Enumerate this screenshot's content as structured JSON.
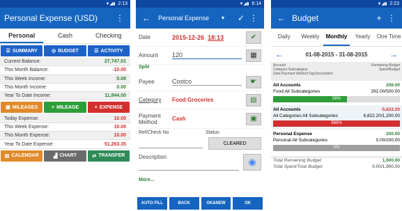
{
  "phone1": {
    "time": "2:13",
    "title": "Personal Expense (USD)",
    "tabs": [
      "Personal",
      "Cash",
      "Checking"
    ],
    "top_buttons": [
      "SUMMARY",
      "BUDGET",
      "ACTIVITY"
    ],
    "rows_a": [
      {
        "label": "Current Balance:",
        "value": "27,747.01",
        "type": "pos"
      },
      {
        "label": "This Month Balance:",
        "value": "-10.00",
        "type": "neg"
      },
      {
        "label": "This Week Income:",
        "value": "0.00",
        "type": "pos"
      },
      {
        "label": "This Month Income:",
        "value": "0.00",
        "type": "pos"
      },
      {
        "label": "Year To Date Income:",
        "value": "11,844.00",
        "type": "pos"
      }
    ],
    "mid_buttons": [
      "MILEAGES",
      "MILEAGE",
      "EXPENSE"
    ],
    "rows_b": [
      {
        "label": "Today Expense:",
        "value": "10.00",
        "type": "neg"
      },
      {
        "label": "This Week Expense:",
        "value": "10.00",
        "type": "neg"
      },
      {
        "label": "This Month Expense:",
        "value": "10.00",
        "type": "neg"
      },
      {
        "label": "Year To Date Expense:",
        "value": "51,263.35",
        "type": "neg"
      }
    ],
    "bottom_buttons": [
      "CALENDAR",
      "CHART",
      "TRANSFER"
    ]
  },
  "phone2": {
    "time": "6:14",
    "title": "Personal Expense",
    "date_label": "Date",
    "date_value": "2015-12-26",
    "time_value": "18:13",
    "amount_label": "Amount",
    "amount_value": "120",
    "split_label": "Split",
    "payee_label": "Payee",
    "payee_value": "Costco",
    "category_label": "Category",
    "category_value": "Food:Groceries",
    "payment_label_1": "Payment",
    "payment_label_2": "Method",
    "payment_value": "Cash",
    "ref_label": "Ref/Check No",
    "status_label": "Status",
    "status_value": "CLEARED",
    "description_label": "Description",
    "more_label": "More...",
    "buttons": [
      "AUTO FILL",
      "BACK",
      "OK&NEW",
      "OK"
    ]
  },
  "phone3": {
    "time": "2:23",
    "title": "Budget",
    "tabs": [
      "Daily",
      "Weekly",
      "Monthly",
      "Yearly",
      "One Time"
    ],
    "date_range": "01-08-2015 - 31-08-2015",
    "header_left": [
      "Account",
      "Category:Subcategory",
      "Date;Payment Method;Tag;Description"
    ],
    "header_right": [
      "Remaining Budget",
      "Spent/Budget"
    ],
    "groups": [
      {
        "name": "All Accounts",
        "value": "208.00",
        "sub": "Food:All Subcategories",
        "subvalue": "292.00/500.00",
        "pct": "58%",
        "fill": 0.58,
        "color": "#2e9e3a",
        "valcolor": "pos"
      },
      {
        "name": "All Accounts",
        "value": "-5,622.20",
        "sub": "All Categories:All Subcategories",
        "subvalue": "6,822.20/1,200.00",
        "pct": "569%",
        "fill": 1.0,
        "color": "#d32f2f",
        "valcolor": "neg"
      },
      {
        "name": "Personal Expense",
        "value": "200.00",
        "sub": "Personal:All Subcategories",
        "subvalue": "0.00/200.00",
        "pct": "0%",
        "fill": 0.0,
        "color": "#2e9e3a",
        "valcolor": "pos"
      }
    ],
    "footer": [
      {
        "label": "Total Remaining Budget",
        "value": "1,900.00"
      },
      {
        "label": "Total Spent/Total Budget",
        "value": "0.00/1,900.00"
      }
    ]
  }
}
